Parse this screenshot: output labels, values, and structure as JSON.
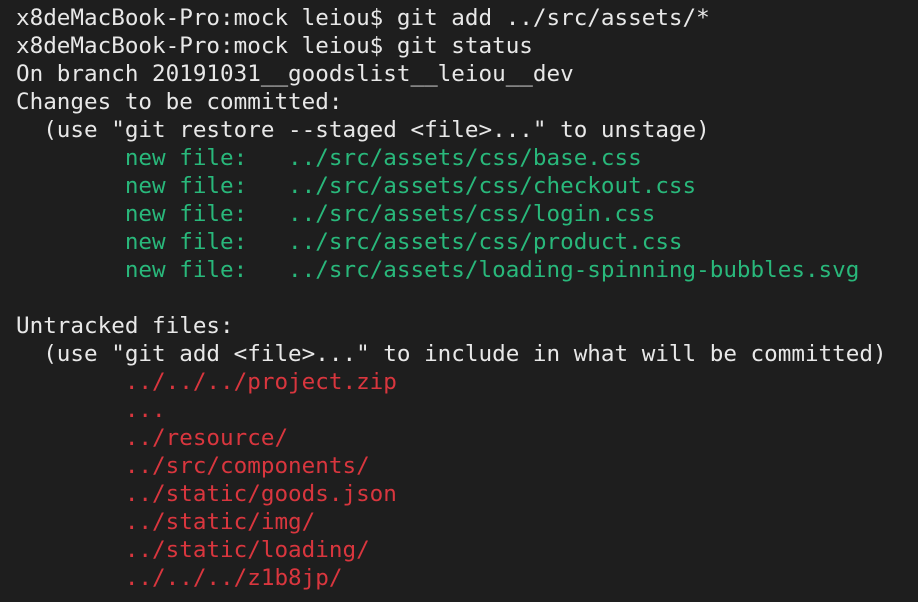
{
  "terminal": {
    "colors": {
      "background": "#1e1e1e",
      "default": "#e8e8e8",
      "staged": "#29b87b",
      "untracked": "#d9363e"
    },
    "commands": [
      "x8deMacBook-Pro:mock leiou$ git add ../src/assets/*",
      "x8deMacBook-Pro:mock leiou$ git status"
    ],
    "branch_line": "On branch 20191031__goodslist__leiou__dev",
    "staged_header": "Changes to be committed:",
    "staged_hint": "  (use \"git restore --staged <file>...\" to unstage)",
    "staged_files": [
      "\tnew file:   ../src/assets/css/base.css",
      "\tnew file:   ../src/assets/css/checkout.css",
      "\tnew file:   ../src/assets/css/login.css",
      "\tnew file:   ../src/assets/css/product.css",
      "\tnew file:   ../src/assets/loading-spinning-bubbles.svg"
    ],
    "untracked_header": "Untracked files:",
    "untracked_hint": "  (use \"git add <file>...\" to include in what will be committed)",
    "untracked_files": [
      "\t../../../project.zip",
      "\t...",
      "\t../resource/",
      "\t../src/components/",
      "\t../static/goods.json",
      "\t../static/img/",
      "\t../static/loading/",
      "\t../../../z1b8jp/"
    ]
  }
}
